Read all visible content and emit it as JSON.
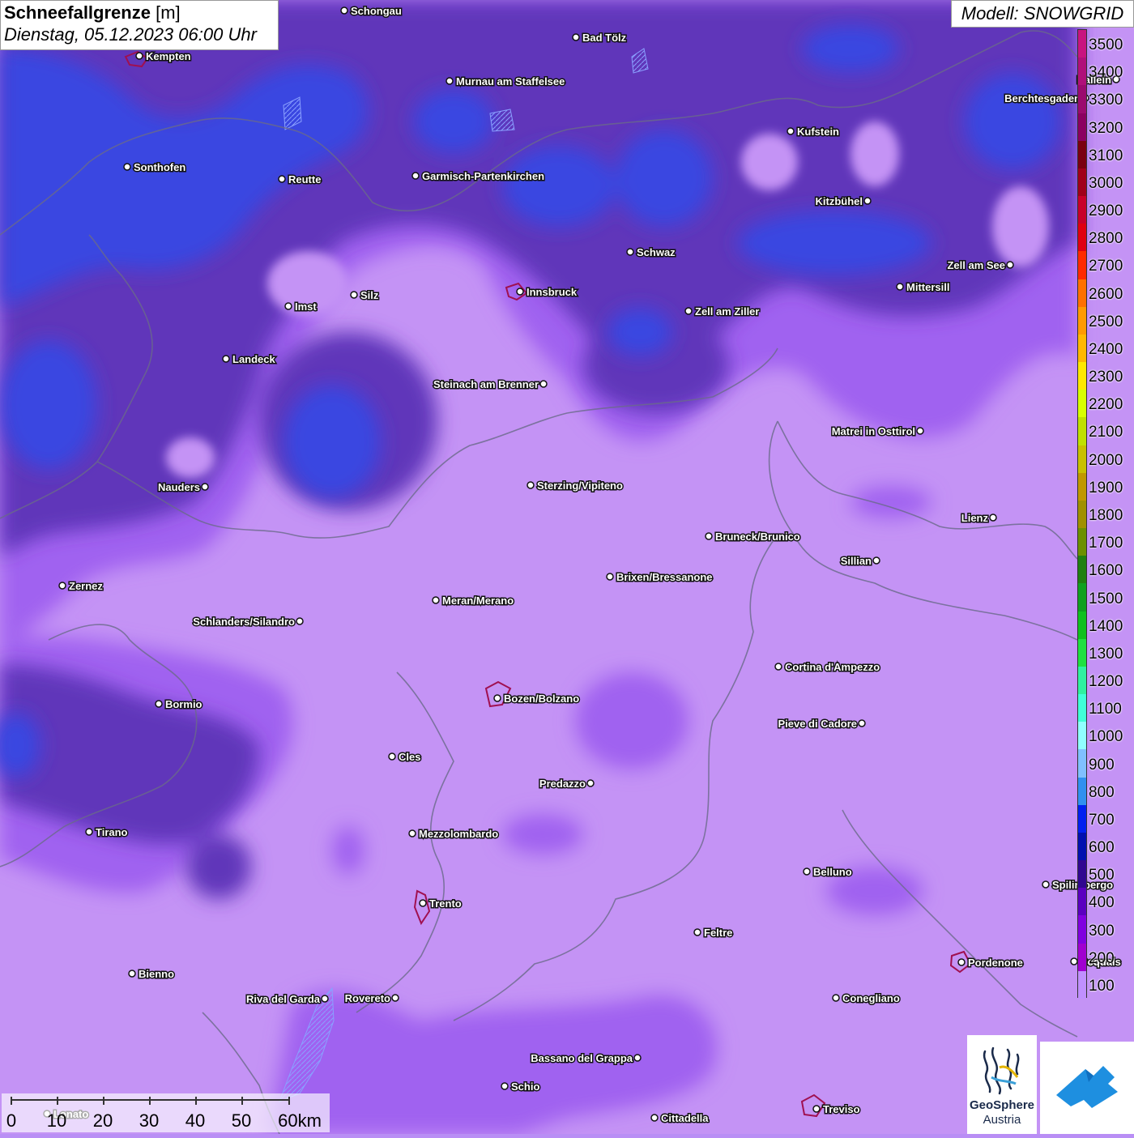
{
  "title": {
    "name": "Schneefallgrenze",
    "unit": "[m]",
    "datetime": "Dienstag, 05.12.2023 06:00 Uhr"
  },
  "model_label": "Modell: SNOWGRID",
  "legend": {
    "values": [
      "3500",
      "3400",
      "3300",
      "3200",
      "3100",
      "3000",
      "2900",
      "2800",
      "2700",
      "2600",
      "2500",
      "2400",
      "2300",
      "2200",
      "2100",
      "2000",
      "1900",
      "1800",
      "1700",
      "1600",
      "1500",
      "1400",
      "1300",
      "1200",
      "1100",
      "1000",
      "900",
      "800",
      "700",
      "600",
      "500",
      "400",
      "300",
      "200",
      "100"
    ],
    "colors": [
      "#c8147f",
      "#b0107a",
      "#9b0a6e",
      "#8b0060",
      "#7a0010",
      "#a0001a",
      "#c8002a",
      "#e00010",
      "#ff2a00",
      "#ff7000",
      "#ff9a00",
      "#ffb800",
      "#ffe800",
      "#d8ff00",
      "#c0e000",
      "#c8c000",
      "#c09800",
      "#a09000",
      "#6c9000",
      "#208010",
      "#10a020",
      "#10c020",
      "#20e040",
      "#30f0a0",
      "#40ffd8",
      "#90ffff",
      "#80c0ff",
      "#3090f0",
      "#0020f0",
      "#0010b0",
      "#300890",
      "#5a00c0",
      "#8000e0",
      "#a000d0",
      "#c090ff"
    ]
  },
  "cities": [
    {
      "name": "Schongau"
    },
    {
      "name": "Bad Tölz"
    },
    {
      "name": "Kempten"
    },
    {
      "name": "Murnau am Staffelsee"
    },
    {
      "name": "Hallein"
    },
    {
      "name": "Berchtesgaden"
    },
    {
      "name": "Kufstein"
    },
    {
      "name": "Sonthofen"
    },
    {
      "name": "Reutte"
    },
    {
      "name": "Garmisch-Partenkirchen"
    },
    {
      "name": "Kitzbühel"
    },
    {
      "name": "Schwaz"
    },
    {
      "name": "Zell am See"
    },
    {
      "name": "Mittersill"
    },
    {
      "name": "Imst"
    },
    {
      "name": "Silz"
    },
    {
      "name": "Innsbruck"
    },
    {
      "name": "Zell am Ziller"
    },
    {
      "name": "Landeck"
    },
    {
      "name": "Steinach am Brenner"
    },
    {
      "name": "Matrei in Osttirol"
    },
    {
      "name": "Nauders"
    },
    {
      "name": "Sterzing/Vipiteno"
    },
    {
      "name": "Lienz"
    },
    {
      "name": "Bruneck/Brunico"
    },
    {
      "name": "Sillian"
    },
    {
      "name": "Zernez"
    },
    {
      "name": "Brixen/Bressanone"
    },
    {
      "name": "Meran/Merano"
    },
    {
      "name": "Schlanders/Silandro"
    },
    {
      "name": "Cortina d'Ampezzo"
    },
    {
      "name": "Bozen/Bolzano"
    },
    {
      "name": "Bormio"
    },
    {
      "name": "Pieve di Cadore"
    },
    {
      "name": "Cles"
    },
    {
      "name": "Predazzo"
    },
    {
      "name": "Tirano"
    },
    {
      "name": "Mezzolombardo"
    },
    {
      "name": "Belluno"
    },
    {
      "name": "Spilimbergo"
    },
    {
      "name": "Trento"
    },
    {
      "name": "Feltre"
    },
    {
      "name": "Pordenone"
    },
    {
      "name": "Sequals"
    },
    {
      "name": "Bienno"
    },
    {
      "name": "Riva del Garda"
    },
    {
      "name": "Rovereto"
    },
    {
      "name": "Conegliano"
    },
    {
      "name": "Bassano del Grappa"
    },
    {
      "name": "Schio"
    },
    {
      "name": "Treviso"
    },
    {
      "name": "Cittadella"
    },
    {
      "name": "Lonato"
    }
  ],
  "scalebar": {
    "labels": [
      "0",
      "10",
      "20",
      "30",
      "40",
      "50",
      "60km"
    ]
  },
  "logos": {
    "geosphere_line1": "GeoSphere",
    "geosphere_line2": "Austria"
  }
}
